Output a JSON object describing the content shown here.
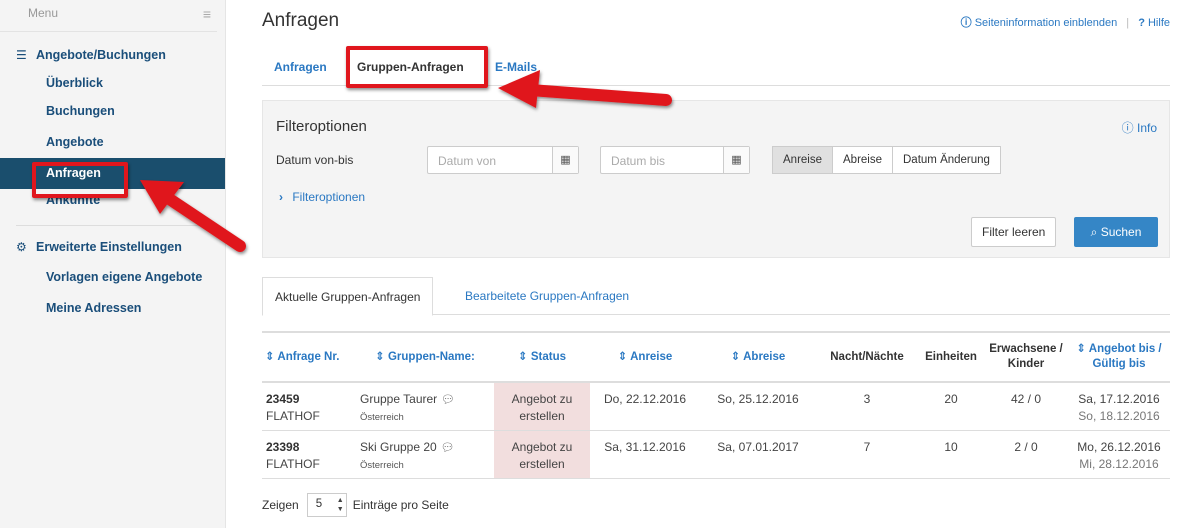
{
  "sidebar": {
    "menu_label": "Menu",
    "group1": {
      "title": "Angebote/Buchungen",
      "items": [
        "Überblick",
        "Buchungen",
        "Angebote",
        "Anfragen",
        "Ankünfte"
      ]
    },
    "group2": {
      "title": "Erweiterte Einstellungen",
      "items": [
        "Vorlagen eigene Angebote",
        "Meine Adressen"
      ]
    }
  },
  "header": {
    "title": "Anfragen",
    "info_link": "Seiteninformation einblenden",
    "help_link": "Hilfe",
    "help_prefix": "?"
  },
  "tabs": [
    "Anfragen",
    "Gruppen-Anfragen",
    "E-Mails"
  ],
  "filter": {
    "title": "Filteroptionen",
    "info": "Info",
    "date_label": "Datum von-bis",
    "date_from_placeholder": "Datum von",
    "date_to_placeholder": "Datum bis",
    "date_types": [
      "Anreise",
      "Abreise",
      "Datum Änderung"
    ],
    "more": "Filteroptionen",
    "clear_button": "Filter leeren",
    "search_button": "Suchen"
  },
  "subtabs": [
    "Aktuelle Gruppen-Anfragen",
    "Bearbeitete Gruppen-Anfragen"
  ],
  "table": {
    "headers": {
      "nr": "Anfrage Nr.",
      "name": "Gruppen-Name:",
      "status": "Status",
      "arrival": "Anreise",
      "departure": "Abreise",
      "nights": "Nacht/Nächte",
      "units": "Einheiten",
      "guests": "Erwachsene / Kinder",
      "valid": "Angebot bis / Gültig bis"
    },
    "rows": [
      {
        "nr": "23459",
        "house": "FLATHOF",
        "name": "Gruppe Taurer",
        "country": "Österreich",
        "status": "Angebot zu erstellen",
        "arrival": "Do, 22.12.2016",
        "departure": "So, 25.12.2016",
        "nights": "3",
        "units": "20",
        "guests": "42 / 0",
        "offer_until": "Sa, 17.12.2016",
        "valid_until": "So, 18.12.2016"
      },
      {
        "nr": "23398",
        "house": "FLATHOF",
        "name": "Ski Gruppe 20",
        "country": "Österreich",
        "status": "Angebot zu erstellen",
        "arrival": "Sa, 31.12.2016",
        "departure": "Sa, 07.01.2017",
        "nights": "7",
        "units": "10",
        "guests": "2 / 0",
        "offer_until": "Mo, 26.12.2016",
        "valid_until": "Mi, 28.12.2016"
      }
    ]
  },
  "pager": {
    "prefix": "Zeigen",
    "value": "5",
    "suffix": "Einträge pro Seite"
  },
  "annotation_color": "#e0161d",
  "accent_color": "#2a78c2",
  "active_nav_color": "#1a4e6d"
}
